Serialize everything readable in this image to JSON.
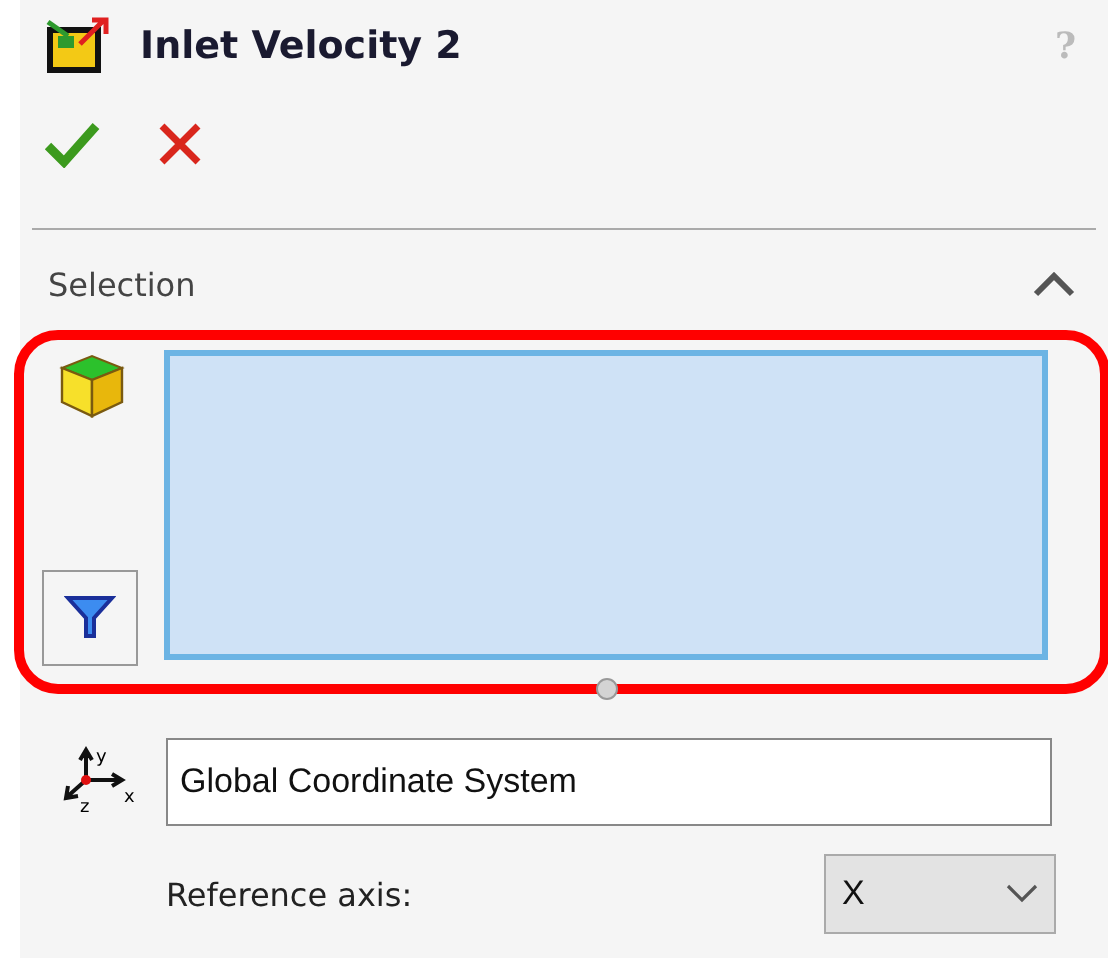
{
  "header": {
    "title": "Inlet Velocity 2",
    "help": "?"
  },
  "actions": [
    {
      "kind": "ok"
    },
    {
      "kind": "cancel"
    }
  ],
  "section": {
    "title": "Selection",
    "expanded": true,
    "selection_box": {
      "highlighted": true
    },
    "coordinate_system": {
      "axis_labels": [
        "y",
        "z",
        "x"
      ],
      "value": "Global Coordinate System"
    },
    "reference_axis": {
      "label": "Reference axis:",
      "value": "X"
    }
  }
}
